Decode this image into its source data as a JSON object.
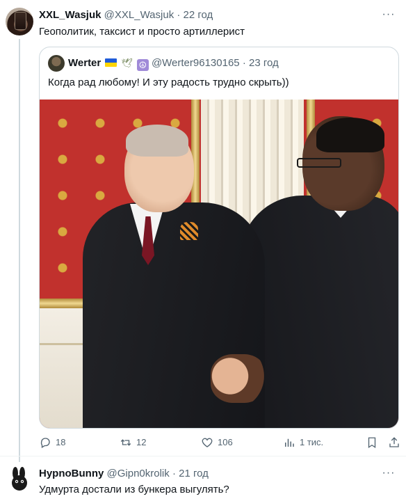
{
  "tweet": {
    "author_name": "XXL_Wasjuk",
    "author_handle": "@XXL_Wasjuk",
    "time": "22 год",
    "text": "Геополитик, таксист и просто артиллерист",
    "more": "···"
  },
  "quote": {
    "author_name": "Werter",
    "author_handle": "@Werter96130165",
    "time": "23 год",
    "text": "Когда рад любому! И эту радость трудно скрыть))",
    "emoji": [
      "ukraine-flag",
      "dove",
      "peace-sign"
    ]
  },
  "actions": {
    "replies": "18",
    "retweets": "12",
    "likes": "106",
    "views": "1 тис."
  },
  "reply": {
    "author_name": "HypnoBunny",
    "author_handle": "@Gipn0krolik",
    "time": "21 год",
    "text": "Удмурта достали из бункера выгулять?"
  },
  "colors": {
    "text": "#0f1419",
    "muted": "#536471",
    "border": "#cfd9de"
  }
}
